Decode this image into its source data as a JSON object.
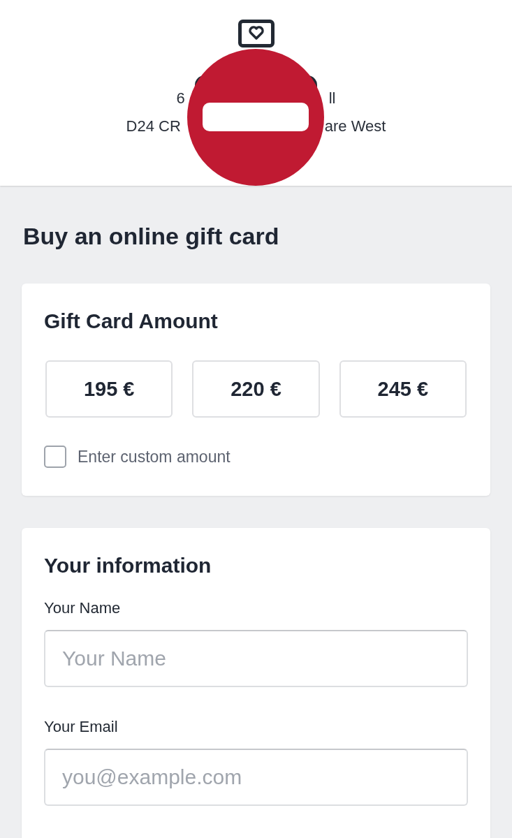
{
  "header": {
    "address_lines": [
      [
        "6",
        "ll"
      ],
      [
        "D24 CR",
        "are West"
      ]
    ]
  },
  "page_title": "Buy an online gift card",
  "amount_card": {
    "title": "Gift Card Amount",
    "amounts": [
      {
        "label": "195 €",
        "selected": false
      },
      {
        "label": "220 €",
        "selected": false
      },
      {
        "label": "245 €",
        "selected": false
      }
    ],
    "custom_amount": {
      "label": "Enter custom amount",
      "checked": false
    }
  },
  "info_card": {
    "title": "Your information",
    "fields": [
      {
        "label": "Your Name",
        "placeholder": "Your Name"
      },
      {
        "label": "Your Email",
        "placeholder": "you@example.com"
      }
    ]
  }
}
